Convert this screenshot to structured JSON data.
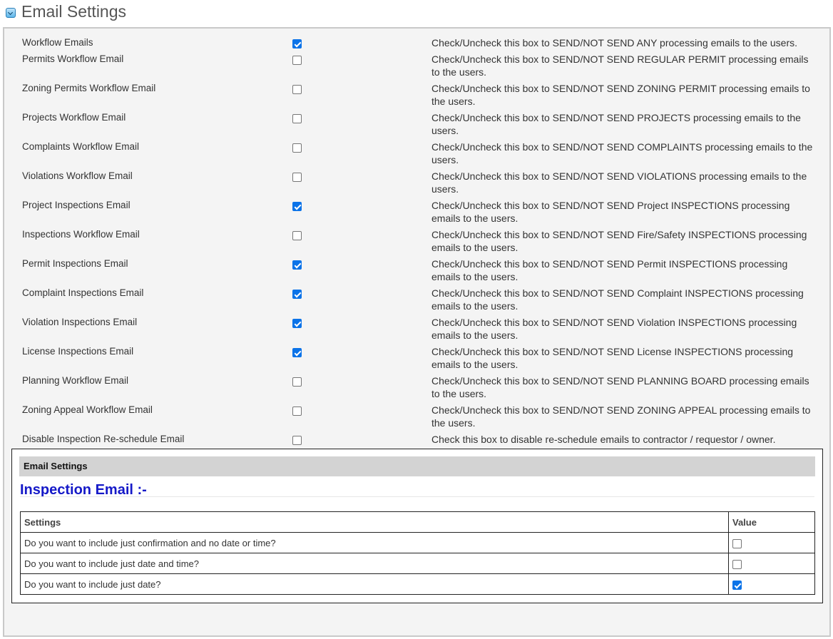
{
  "header": {
    "title": "Email Settings",
    "collapse_icon": "chevron-down-icon"
  },
  "settings": [
    {
      "label": "Workflow Emails",
      "checked": true,
      "description": "Check/Uncheck this box to SEND/NOT SEND ANY processing emails to the users."
    },
    {
      "label": "Permits Workflow Email",
      "checked": false,
      "description": "Check/Uncheck this box to SEND/NOT SEND REGULAR PERMIT processing emails to the users."
    },
    {
      "label": "Zoning Permits Workflow Email",
      "checked": false,
      "description": "Check/Uncheck this box to SEND/NOT SEND ZONING PERMIT processing emails to the users."
    },
    {
      "label": "Projects Workflow Email",
      "checked": false,
      "description": "Check/Uncheck this box to SEND/NOT SEND PROJECTS processing emails to the users."
    },
    {
      "label": "Complaints Workflow Email",
      "checked": false,
      "description": "Check/Uncheck this box to SEND/NOT SEND COMPLAINTS processing emails to the users."
    },
    {
      "label": "Violations Workflow Email",
      "checked": false,
      "description": "Check/Uncheck this box to SEND/NOT SEND VIOLATIONS processing emails to the users."
    },
    {
      "label": "Project Inspections Email",
      "checked": true,
      "description": "Check/Uncheck this box to SEND/NOT SEND Project INSPECTIONS processing emails to the users."
    },
    {
      "label": "Inspections Workflow Email",
      "checked": false,
      "description": "Check/Uncheck this box to SEND/NOT SEND Fire/Safety INSPECTIONS processing emails to the users."
    },
    {
      "label": "Permit Inspections Email",
      "checked": true,
      "description": "Check/Uncheck this box to SEND/NOT SEND Permit INSPECTIONS processing emails to the users."
    },
    {
      "label": "Complaint Inspections Email",
      "checked": true,
      "description": "Check/Uncheck this box to SEND/NOT SEND Complaint INSPECTIONS processing emails to the users."
    },
    {
      "label": "Violation Inspections Email",
      "checked": true,
      "description": "Check/Uncheck this box to SEND/NOT SEND Violation INSPECTIONS processing emails to the users."
    },
    {
      "label": "License Inspections Email",
      "checked": true,
      "description": "Check/Uncheck this box to SEND/NOT SEND License INSPECTIONS processing emails to the users."
    },
    {
      "label": "Planning Workflow Email",
      "checked": false,
      "description": "Check/Uncheck this box to SEND/NOT SEND PLANNING BOARD processing emails to the users."
    },
    {
      "label": "Zoning Appeal Workflow Email",
      "checked": false,
      "description": "Check/Uncheck this box to SEND/NOT SEND ZONING APPEAL processing emails to the users."
    },
    {
      "label": "Disable Inspection Re-schedule Email",
      "checked": false,
      "description": "Check this box to disable re-schedule emails to contractor / requestor / owner."
    }
  ],
  "inspection_section": {
    "header": "Email Settings",
    "heading": "Inspection Email :-",
    "heading_color": "#1519c8",
    "columns": [
      "Settings",
      "Value"
    ],
    "rows": [
      {
        "setting": "Do you want to include just confirmation and no date or time?",
        "checked": false
      },
      {
        "setting": "Do you want to include just date and time?",
        "checked": false
      },
      {
        "setting": "Do you want to include just date?",
        "checked": true
      }
    ]
  },
  "colors": {
    "checkbox_checked": "#0b73e8"
  }
}
